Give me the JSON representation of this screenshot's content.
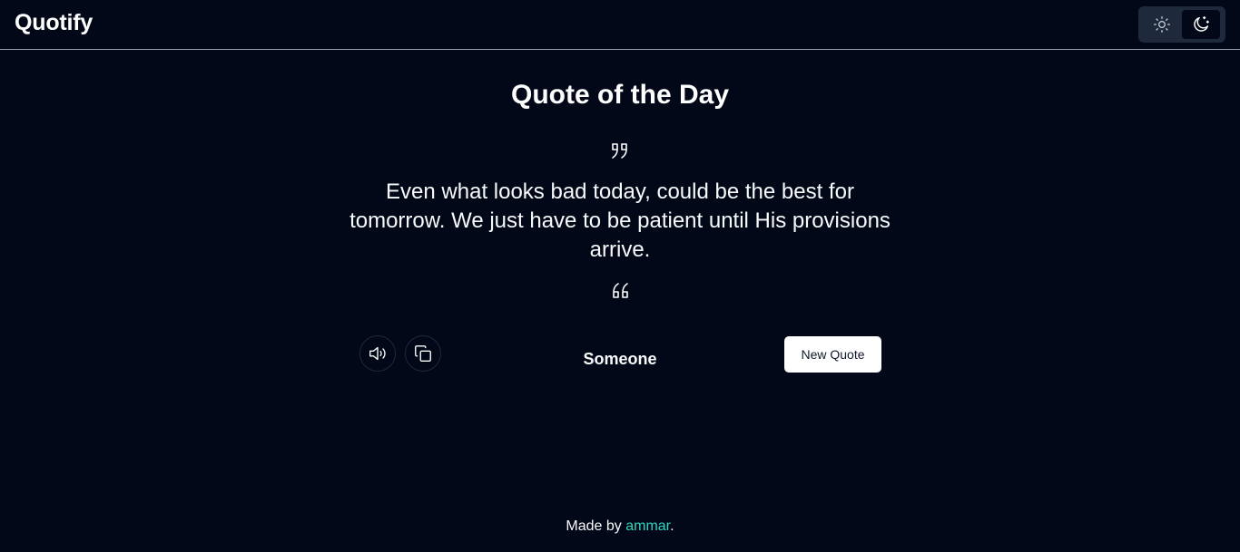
{
  "header": {
    "brand": "Quotify",
    "theme_toggle": {
      "light_icon": "sun-icon",
      "dark_icon": "moon-stars-icon",
      "active": "dark"
    }
  },
  "main": {
    "title": "Quote of the Day",
    "open_quote_icon": "quote-close-icon",
    "quote_text": "Even what looks bad today, could be the best for tomorrow. We just have to be patient until His provisions arrive.",
    "close_quote_icon": "quote-open-icon",
    "author": "Someone",
    "actions": {
      "speak_icon": "speaker-icon",
      "copy_icon": "copy-icon",
      "new_quote_label": "New Quote"
    }
  },
  "footer": {
    "prefix": "Made by ",
    "author_link": "ammar",
    "suffix": "."
  },
  "colors": {
    "background": "#020817",
    "text": "#f8fafc",
    "link": "#2dd4bf",
    "toggle_bg": "#1e293b"
  }
}
